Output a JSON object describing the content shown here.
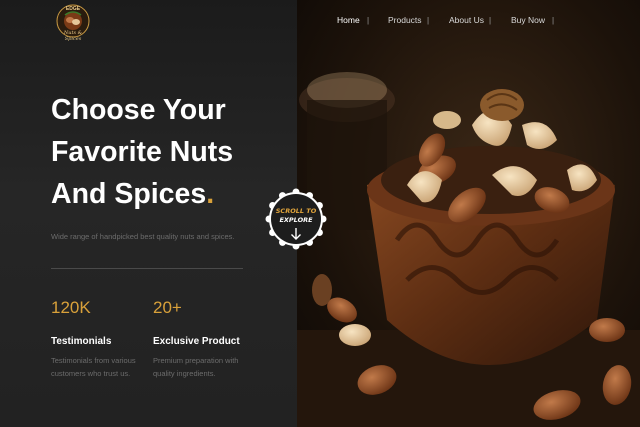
{
  "brand": {
    "name": "EDGE",
    "tagline": "Nuts & Spices"
  },
  "nav": {
    "items": [
      {
        "label": "Home",
        "active": true
      },
      {
        "label": "Products",
        "active": false
      },
      {
        "label": "About Us",
        "active": false
      },
      {
        "label": "Buy Now",
        "active": false
      }
    ],
    "separator": "|"
  },
  "hero": {
    "title_line1": "Choose Your",
    "title_line2": "Favorite Nuts",
    "title_line3": "And Spices",
    "title_dot": ".",
    "subtitle": "Wide range of handpicked best quality nuts and spices."
  },
  "stats": [
    {
      "value": "120K",
      "title": "Testimonials",
      "desc_line1": "Testimonials from various",
      "desc_line2": "customers who trust us."
    },
    {
      "value": "20+",
      "title": "Exclusive Product",
      "desc_line1": "Premium preparation with",
      "desc_line2": "quality ingredients."
    }
  ],
  "scroll_badge": {
    "line1": "SCROLL TO",
    "line2": "EXPLORE",
    "icon": "arrow-down-icon"
  },
  "hero_image": {
    "icon": "nuts-bowl-image"
  },
  "colors": {
    "accent": "#d9a13a",
    "background": "#1f1f1f"
  }
}
